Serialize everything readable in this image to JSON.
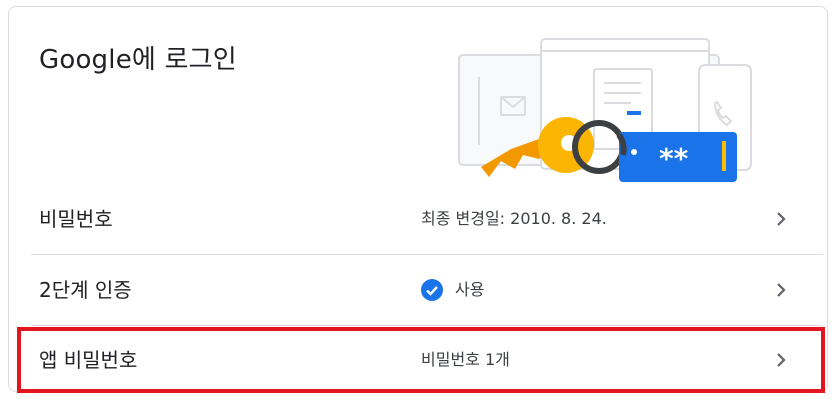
{
  "card": {
    "title": "Google에 로그인"
  },
  "rows": [
    {
      "label": "비밀번호",
      "value": "최종 변경일: 2010. 8. 24.",
      "icon": "chevron-right-icon"
    },
    {
      "label": "2단계 인증",
      "value": "사용",
      "status_icon": "check-circle-icon",
      "status_color": "#1a73e8",
      "icon": "chevron-right-icon"
    },
    {
      "label": "앱 비밀번호",
      "value": "비밀번호 1개",
      "icon": "chevron-right-icon",
      "highlighted": true
    }
  ],
  "illustration": {
    "password_mask": "**",
    "icons": [
      "laptop-icon",
      "mail-icon",
      "phone-icon",
      "key-icon",
      "password-field-icon"
    ]
  },
  "colors": {
    "highlight_border": "#e3151e",
    "accent_blue": "#1a73e8",
    "key_yellow": "#f9ab00"
  }
}
